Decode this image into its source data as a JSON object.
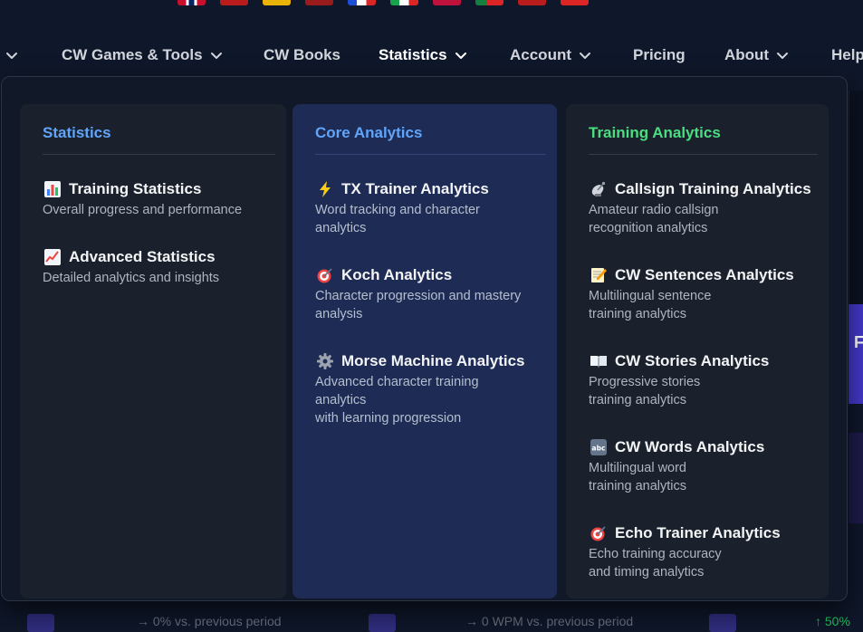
{
  "flags": [
    "uk",
    "de1",
    "es",
    "red1",
    "fr",
    "it",
    "red2",
    "pt",
    "red3",
    "red4"
  ],
  "nav": {
    "items": [
      {
        "label": "CW Games & Tools",
        "has_chevron": true
      },
      {
        "label": "CW Books",
        "has_chevron": false
      },
      {
        "label": "Statistics",
        "has_chevron": true,
        "active": true
      },
      {
        "label": "Account",
        "has_chevron": true
      },
      {
        "label": "Pricing",
        "has_chevron": false
      },
      {
        "label": "About",
        "has_chevron": true
      },
      {
        "label": "Help",
        "has_chevron": false
      }
    ]
  },
  "dropdown": {
    "columns": [
      {
        "heading": "Statistics",
        "heading_color": "#60a5fa",
        "entries": [
          {
            "icon": "bar-chart-icon",
            "title": "Training Statistics",
            "desc": "Overall progress and performance"
          },
          {
            "icon": "trend-up-icon",
            "title": "Advanced Statistics",
            "desc": "Detailed analytics and insights"
          }
        ]
      },
      {
        "heading": "Core Analytics",
        "heading_color": "#60a5fa",
        "entries": [
          {
            "icon": "lightning-icon",
            "title": "TX Trainer Analytics",
            "desc": "Word tracking and character\nanalytics"
          },
          {
            "icon": "target-icon",
            "title": "Koch Analytics",
            "desc": "Character progression and mastery\nanalysis"
          },
          {
            "icon": "gear-icon",
            "title": "Morse Machine Analytics",
            "desc": "Advanced character training\nanalytics\nwith learning progression"
          }
        ]
      },
      {
        "heading": "Training Analytics",
        "heading_color": "#4ade80",
        "entries": [
          {
            "icon": "satellite-dish-icon",
            "title": "Callsign Training Analytics",
            "desc": "Amateur radio callsign\nrecognition analytics"
          },
          {
            "icon": "memo-icon",
            "title": "CW Sentences Analytics",
            "desc": "Multilingual sentence\ntraining analytics"
          },
          {
            "icon": "open-book-icon",
            "title": "CW Stories Analytics",
            "desc": "Progressive stories\ntraining analytics"
          },
          {
            "icon": "abc-icon",
            "title": "CW Words Analytics",
            "desc": "Multilingual word\ntraining analytics"
          },
          {
            "icon": "target-icon",
            "title": "Echo Trainer Analytics",
            "desc": "Echo training accuracy\nand timing analytics"
          }
        ]
      }
    ]
  },
  "background": {
    "peek_letter": "F",
    "footer": [
      "→ 0% vs. previous period",
      "→ 0 WPM vs. previous period",
      "↑ 50%"
    ]
  }
}
